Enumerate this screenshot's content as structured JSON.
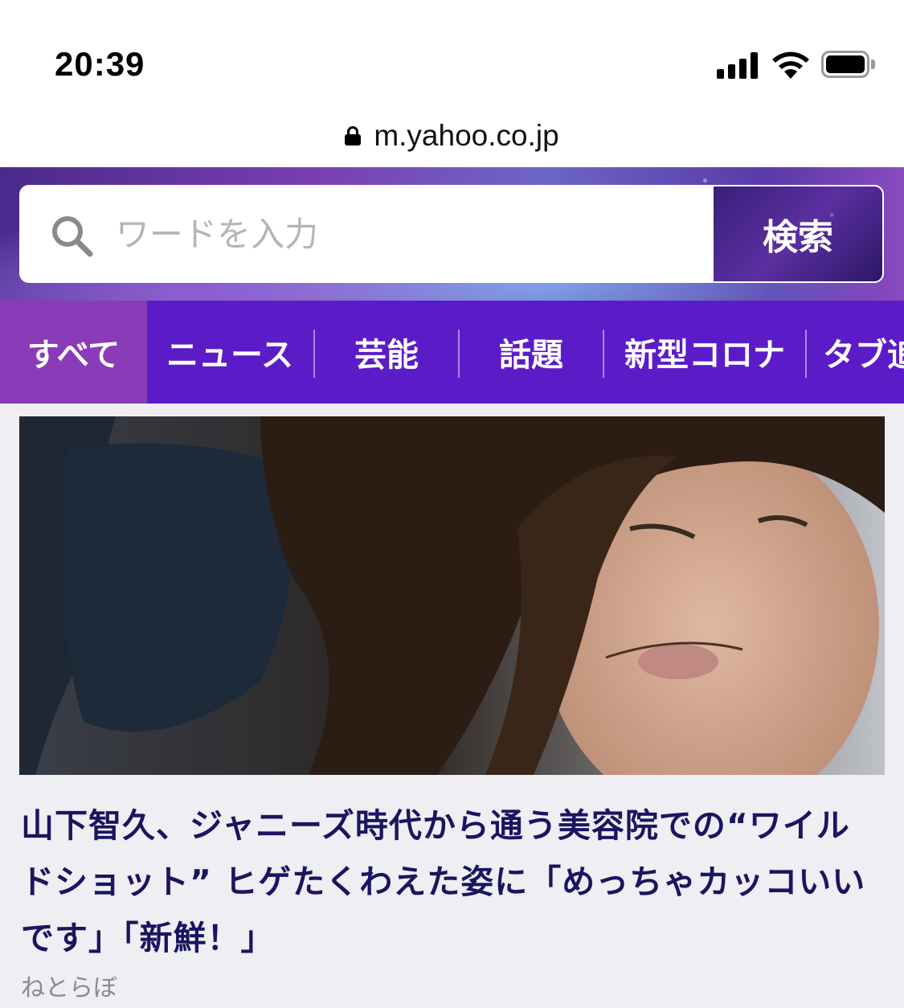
{
  "status_bar": {
    "time": "20:39"
  },
  "url_bar": {
    "url": "m.yahoo.co.jp",
    "icon": "lock-icon"
  },
  "search": {
    "placeholder": "ワードを入力",
    "button_label": "検索",
    "icon": "search-icon"
  },
  "tabs": [
    {
      "label": "すべて",
      "active": true
    },
    {
      "label": "ニュース",
      "active": false
    },
    {
      "label": "芸能",
      "active": false
    },
    {
      "label": "話題",
      "active": false
    },
    {
      "label": "新型コロナ",
      "active": false
    },
    {
      "label": "タブ追",
      "active": false
    }
  ],
  "article": {
    "image_alt": "long-haired man with beard photo",
    "headline": "山下智久、ジャニーズ時代から通う美容院での“ワイルドショット” ヒゲたくわえた姿に「めっちゃカッコいいです」「新鮮！」",
    "source": "ねとらぼ"
  },
  "colors": {
    "tab_bar": "#5b1cc8",
    "tab_active": "#8a3cb8",
    "headline": "#1a1560"
  }
}
